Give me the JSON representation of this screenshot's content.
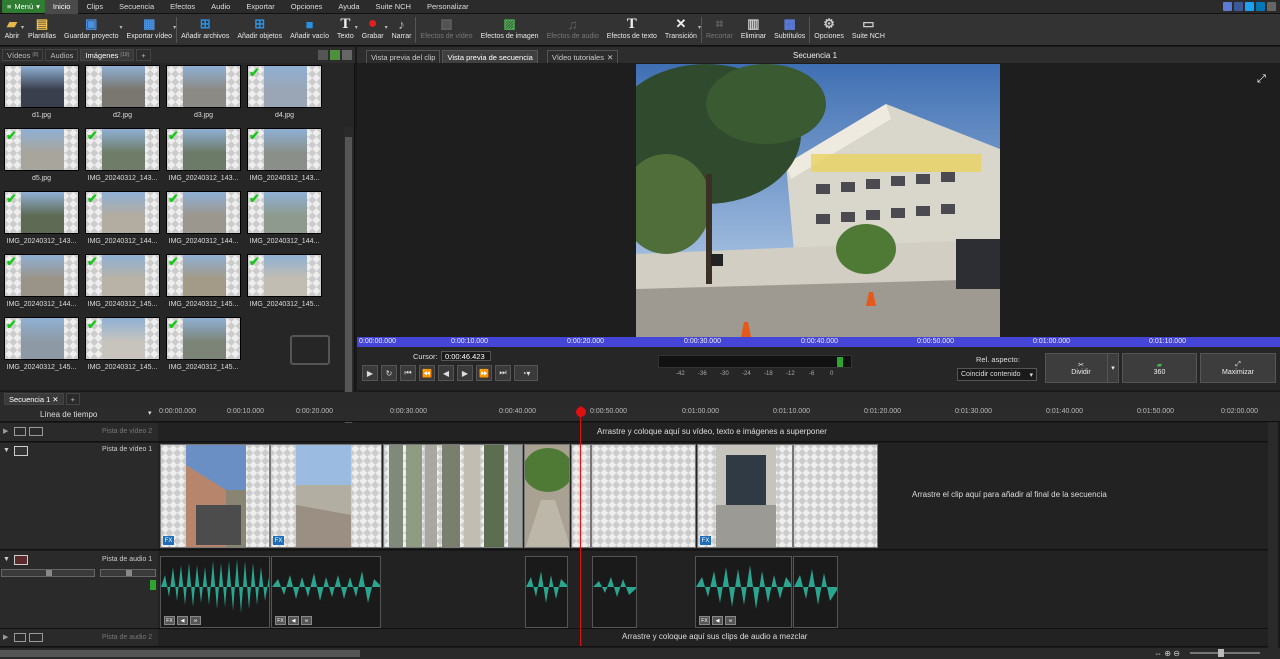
{
  "menubar": {
    "menu_label": "Menú",
    "tabs": [
      "Inicio",
      "Clips",
      "Secuencia",
      "Efectos",
      "Audio",
      "Exportar",
      "Opciones",
      "Ayuda",
      "Suite NCH",
      "Personalizar"
    ],
    "active_tab": "Inicio"
  },
  "toolbar": {
    "buttons": [
      {
        "label": "Abrir",
        "icon": "folder-open-icon",
        "enabled": true
      },
      {
        "label": "Plantillas",
        "icon": "templates-icon",
        "enabled": true
      },
      {
        "label": "Guardar proyecto",
        "icon": "save-icon",
        "enabled": true
      },
      {
        "label": "Exportar vídeo",
        "icon": "export-video-icon",
        "enabled": true
      },
      {
        "label": "Añadir archivos",
        "icon": "add-files-icon",
        "enabled": true
      },
      {
        "label": "Añadir objetos",
        "icon": "add-objects-icon",
        "enabled": true
      },
      {
        "label": "Añadir vacío",
        "icon": "add-blank-icon",
        "enabled": true
      },
      {
        "label": "Texto",
        "icon": "text-icon",
        "enabled": true
      },
      {
        "label": "Grabar",
        "icon": "record-icon",
        "enabled": true
      },
      {
        "label": "Narrar",
        "icon": "microphone-icon",
        "enabled": true
      },
      {
        "label": "Efectos de vídeo",
        "icon": "video-effects-icon",
        "enabled": false
      },
      {
        "label": "Efectos de imagen",
        "icon": "image-effects-icon",
        "enabled": true
      },
      {
        "label": "Efectos de audio",
        "icon": "audio-effects-icon",
        "enabled": false
      },
      {
        "label": "Efectos de texto",
        "icon": "text-effects-icon",
        "enabled": true
      },
      {
        "label": "Transición",
        "icon": "transition-icon",
        "enabled": true
      },
      {
        "label": "Recortar",
        "icon": "crop-icon",
        "enabled": false
      },
      {
        "label": "Eliminar",
        "icon": "delete-icon",
        "enabled": true
      },
      {
        "label": "Subtítulos",
        "icon": "subtitles-icon",
        "enabled": true
      },
      {
        "label": "Opciones",
        "icon": "options-icon",
        "enabled": true
      },
      {
        "label": "Suite NCH",
        "icon": "nch-suite-icon",
        "enabled": true
      }
    ]
  },
  "media": {
    "tabs": [
      {
        "label": "Vídeos",
        "count": "(8)"
      },
      {
        "label": "Audios",
        "count": ""
      },
      {
        "label": "Imágenes",
        "count": "(19)"
      }
    ],
    "items": [
      {
        "name": "d1.jpg",
        "used": false,
        "tone": "#3a3f4d"
      },
      {
        "name": "d2.jpg",
        "used": false,
        "tone": "#7a7770"
      },
      {
        "name": "d3.jpg",
        "used": false,
        "tone": "#8c8a85"
      },
      {
        "name": "d4.jpg",
        "used": true,
        "tone": "#9aa6b5"
      },
      {
        "name": "d5.jpg",
        "used": true,
        "tone": "#a7a59c"
      },
      {
        "name": "IMG_20240312_143...",
        "used": true,
        "tone": "#6f7d68"
      },
      {
        "name": "IMG_20240312_143...",
        "used": true,
        "tone": "#6c7a68"
      },
      {
        "name": "IMG_20240312_143...",
        "used": true,
        "tone": "#8a8f8a"
      },
      {
        "name": "IMG_20240312_143...",
        "used": true,
        "tone": "#5e6a54"
      },
      {
        "name": "IMG_20240312_144...",
        "used": true,
        "tone": "#b3aca0"
      },
      {
        "name": "IMG_20240312_144...",
        "used": true,
        "tone": "#9c978e"
      },
      {
        "name": "IMG_20240312_144...",
        "used": true,
        "tone": "#8e9a8e"
      },
      {
        "name": "IMG_20240312_144...",
        "used": true,
        "tone": "#9a9488"
      },
      {
        "name": "IMG_20240312_145...",
        "used": true,
        "tone": "#b8b3a6"
      },
      {
        "name": "IMG_20240312_145...",
        "used": true,
        "tone": "#a39a87"
      },
      {
        "name": "IMG_20240312_145...",
        "used": true,
        "tone": "#c2bdb2"
      },
      {
        "name": "IMG_20240312_145...",
        "used": true,
        "tone": "#8d9aa5"
      },
      {
        "name": "IMG_20240312_145...",
        "used": true,
        "tone": "#c7c4bd"
      },
      {
        "name": "IMG_20240312_145...",
        "used": true,
        "tone": "#7c8477"
      }
    ]
  },
  "preview": {
    "tabs": [
      "Vista previa del clip",
      "Vista previa de secuencia",
      "Vídeo tutoriales"
    ],
    "active_tab": "Vista previa de secuencia",
    "title": "Secuencia 1",
    "ruler_times": [
      "0:00:00.000",
      "0:00:10.000",
      "0:00:20.000",
      "0:00:30.000",
      "0:00:40.000",
      "0:00:50.000",
      "0:01:00.000",
      "0:01:10.000"
    ],
    "cursor_label": "Cursor:",
    "cursor_value": "0:00:46.423",
    "meter_labels": [
      "-42",
      "-36",
      "-30",
      "-24",
      "-18",
      "-12",
      "-6",
      "0"
    ],
    "aspect_label": "Rel. aspecto:",
    "aspect_value": "Coincidir contenido",
    "split_label": "Dividir",
    "btn360_label": "360",
    "maximize_label": "Maximizar"
  },
  "timeline": {
    "sequence_tab": "Secuencia 1",
    "ruler_label": "Línea de tiempo",
    "ruler_times": [
      "0:00:00.000",
      "0:00:10.000",
      "0:00:20.000",
      "0:00:30.000",
      "0:00:40.000",
      "0:00:50.000",
      "0:01:00.000",
      "0:01:10.000",
      "0:01:20.000",
      "0:01:30.000",
      "0:01:40.000",
      "0:01:50.000",
      "0:02:00.000"
    ],
    "tracks": {
      "video2": "Pista de vídeo 2",
      "video1": "Pista de vídeo 1",
      "audio1": "Pista de audio 1",
      "audio2": "Pista de audio 2"
    },
    "hints": {
      "overlay": "Arrastre y coloque aquí su vídeo, texto e imágenes a superponer",
      "append": "Arrastre el clip aquí para añadir al final de la secuencia",
      "mix": "Arrastre y coloque aquí sus clips de audio a mezclar"
    }
  },
  "colors": {
    "accent_green": "#2e7d32",
    "ruler_blue": "#4545d8",
    "playhead_red": "#e01010",
    "wave_teal": "#2aa58f",
    "check_green": "#19c619"
  }
}
